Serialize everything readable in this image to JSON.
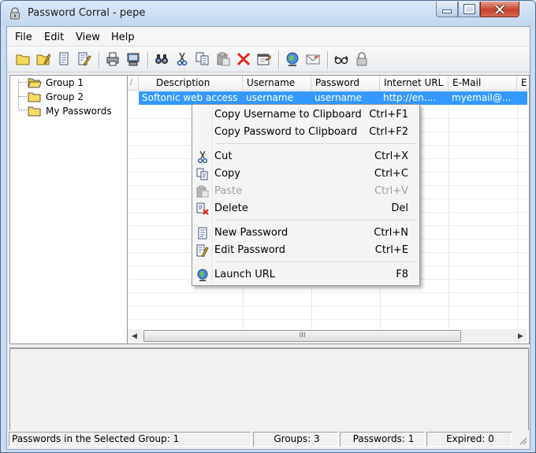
{
  "window": {
    "title": "Password Corral - pepe"
  },
  "menubar": [
    "File",
    "Edit",
    "View",
    "Help"
  ],
  "tree": {
    "items": [
      {
        "label": "Group 1"
      },
      {
        "label": "Group 2"
      },
      {
        "label": "My Passwords"
      }
    ]
  },
  "list": {
    "columns": [
      "/",
      "Description",
      "Username",
      "Password",
      "Internet URL",
      "E-Mail",
      "E"
    ],
    "selected_row": {
      "description": "Softonic web access",
      "username": "username",
      "password": "username",
      "url": "http://en....",
      "email": "myemail@..."
    },
    "scroll_grip": "III"
  },
  "context_menu": {
    "items": [
      {
        "label": "Copy Username to Clipboard",
        "shortcut": "Ctrl+F1"
      },
      {
        "label": "Copy Password to Clipboard",
        "shortcut": "Ctrl+F2"
      },
      {
        "label": "Cut",
        "shortcut": "Ctrl+X",
        "icon": "scissors-icon"
      },
      {
        "label": "Copy",
        "shortcut": "Ctrl+C",
        "icon": "copy-icon"
      },
      {
        "label": "Paste",
        "shortcut": "Ctrl+V",
        "icon": "paste-icon",
        "disabled": true
      },
      {
        "label": "Delete",
        "shortcut": "Del",
        "icon": "delete-icon"
      },
      {
        "label": "New Password",
        "shortcut": "Ctrl+N",
        "icon": "new-password-icon"
      },
      {
        "label": "Edit Password",
        "shortcut": "Ctrl+E",
        "icon": "edit-password-icon"
      },
      {
        "label": "Launch URL",
        "shortcut": "F8",
        "icon": "globe-icon"
      }
    ]
  },
  "statusbar": {
    "selected_group": "Passwords in the Selected Group: 1",
    "groups": "Groups: 3",
    "passwords": "Passwords: 1",
    "expired": "Expired: 0"
  },
  "colors": {
    "selection": "#3399ff",
    "close_button": "#c7422c",
    "folder": "#f5d94e"
  }
}
